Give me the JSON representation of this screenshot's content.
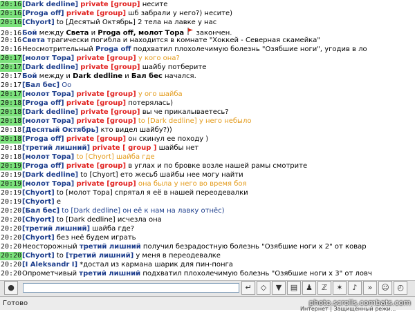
{
  "chat": {
    "rows": [
      {
        "time": "20:16",
        "hl": true,
        "segs": [
          {
            "t": "[Dark dedline]",
            "c": "nick"
          },
          {
            "t": " "
          },
          {
            "t": "private [group]",
            "c": "priv"
          },
          {
            "t": " несите"
          }
        ]
      },
      {
        "time": "20:16",
        "hl": true,
        "segs": [
          {
            "t": "[Proga off]",
            "c": "nick"
          },
          {
            "t": " "
          },
          {
            "t": "private [group]",
            "c": "priv"
          },
          {
            "t": " шб забрали у него?) несите)"
          }
        ]
      },
      {
        "time": "20:16",
        "hl": true,
        "segs": [
          {
            "t": "[Chyort]",
            "c": "nick"
          },
          {
            "t": " to [Десятый Октябрь] 2 тела на лавке у нас"
          }
        ]
      },
      {
        "time": "20:16",
        "hl": false,
        "segs": [
          {
            "t": "Бой",
            "c": "blu bold"
          },
          {
            "t": " между "
          },
          {
            "t": "Света",
            "c": "bold"
          },
          {
            "t": " и "
          },
          {
            "t": "Proga off, молот Тора",
            "c": "bold"
          },
          {
            "t": " ",
            "icon": "flag-icon"
          },
          {
            "t": " закончен."
          }
        ]
      },
      {
        "time": "20:16",
        "hl": false,
        "segs": [
          {
            "t": "Света",
            "c": "blu bold"
          },
          {
            "t": " трагически погибла и находится в комнате \"Хоккей - Северная скамейка\""
          }
        ]
      },
      {
        "time": "20:16",
        "hl": false,
        "segs": [
          {
            "t": "Неосмотрительный "
          },
          {
            "t": "Proga off",
            "c": "blu bold"
          },
          {
            "t": " подхватил плохолечимую болезнь \"Озябшие ноги\", угодив в ло"
          }
        ]
      },
      {
        "time": "20:17",
        "hl": true,
        "segs": [
          {
            "t": "[молот Тора]",
            "c": "nick"
          },
          {
            "t": " "
          },
          {
            "t": "private [group]",
            "c": "priv"
          },
          {
            "t": " у кого она?",
            "c": "ora"
          }
        ]
      },
      {
        "time": "20:17",
        "hl": true,
        "segs": [
          {
            "t": "[Dark dedline]",
            "c": "nick"
          },
          {
            "t": " "
          },
          {
            "t": "private [group]",
            "c": "priv"
          },
          {
            "t": " шайбу потберите"
          }
        ]
      },
      {
        "time": "20:17",
        "hl": false,
        "segs": [
          {
            "t": "Бой",
            "c": "blu bold"
          },
          {
            "t": " между и "
          },
          {
            "t": "Dark dedline",
            "c": "bold"
          },
          {
            "t": " и "
          },
          {
            "t": "Бал бес",
            "c": "bold"
          },
          {
            "t": " начался."
          }
        ]
      },
      {
        "time": "20:17",
        "hl": false,
        "segs": [
          {
            "t": "[Бал бес]",
            "c": "nick"
          },
          {
            "t": " Оо",
            "c": "blu"
          }
        ]
      },
      {
        "time": "20:17",
        "hl": true,
        "segs": [
          {
            "t": "[молот Тора]",
            "c": "nick"
          },
          {
            "t": " "
          },
          {
            "t": "private [group]",
            "c": "priv"
          },
          {
            "t": " у ого шайба",
            "c": "ora"
          }
        ]
      },
      {
        "time": "20:18",
        "hl": true,
        "segs": [
          {
            "t": "[Proga off]",
            "c": "nick"
          },
          {
            "t": " "
          },
          {
            "t": "private [group]",
            "c": "priv"
          },
          {
            "t": " потерялась)"
          }
        ]
      },
      {
        "time": "20:18",
        "hl": true,
        "segs": [
          {
            "t": "[Dark dedline]",
            "c": "nick"
          },
          {
            "t": " "
          },
          {
            "t": "private [group]",
            "c": "priv"
          },
          {
            "t": " вы че прикалываетесь?"
          }
        ]
      },
      {
        "time": "20:18",
        "hl": true,
        "segs": [
          {
            "t": "[молот Тора]",
            "c": "nick"
          },
          {
            "t": " "
          },
          {
            "t": "private [group]",
            "c": "priv"
          },
          {
            "t": " to [Dark dedline] у него небыло",
            "c": "ora"
          }
        ]
      },
      {
        "time": "20:18",
        "hl": false,
        "segs": [
          {
            "t": "[Десятый Октябрь]",
            "c": "nick"
          },
          {
            "t": " кто видел шайбу?))"
          }
        ]
      },
      {
        "time": "20:18",
        "hl": true,
        "segs": [
          {
            "t": "[Proga off]",
            "c": "nick"
          },
          {
            "t": " "
          },
          {
            "t": "private [group]",
            "c": "priv"
          },
          {
            "t": " он скинул ее походу )"
          }
        ]
      },
      {
        "time": "20:18",
        "hl": false,
        "segs": [
          {
            "t": "[третий лишний]",
            "c": "nick"
          },
          {
            "t": " "
          },
          {
            "t": "private [ group ]",
            "c": "priv"
          },
          {
            "t": " шайбы нет"
          }
        ]
      },
      {
        "time": "20:18",
        "hl": false,
        "segs": [
          {
            "t": "[молот Тора]",
            "c": "nick"
          },
          {
            "t": " to [Chyort] шайба где",
            "c": "ora"
          }
        ]
      },
      {
        "time": "20:19",
        "hl": true,
        "segs": [
          {
            "t": "[Proga off]",
            "c": "nick"
          },
          {
            "t": " "
          },
          {
            "t": "private [group]",
            "c": "priv"
          },
          {
            "t": " в углах и по бровке возле нашей рамы смотрите"
          }
        ]
      },
      {
        "time": "20:19",
        "hl": false,
        "segs": [
          {
            "t": "[Dark dedline]",
            "c": "nick"
          },
          {
            "t": " to [Chyort] ето жесьб шайбы нее могу найти"
          }
        ]
      },
      {
        "time": "20:19",
        "hl": true,
        "segs": [
          {
            "t": "[молот Тора]",
            "c": "nick"
          },
          {
            "t": " "
          },
          {
            "t": "private [group]",
            "c": "priv"
          },
          {
            "t": " она была у него во время боя",
            "c": "ora"
          }
        ]
      },
      {
        "time": "20:19",
        "hl": false,
        "segs": [
          {
            "t": "[Chyort]",
            "c": "nick"
          },
          {
            "t": " to [молот Тора] спрятал я её в нашей переодевалки"
          }
        ]
      },
      {
        "time": "20:19",
        "hl": false,
        "segs": [
          {
            "t": "[Chyort]",
            "c": "nick"
          },
          {
            "t": " е"
          }
        ]
      },
      {
        "time": "20:20",
        "hl": false,
        "segs": [
          {
            "t": "[Бал бес]",
            "c": "nick"
          },
          {
            "t": " to [Dark dedline] он её к нам на лавку отнёс)",
            "c": "blu"
          }
        ]
      },
      {
        "time": "20:20",
        "hl": false,
        "segs": [
          {
            "t": "[Chyort]",
            "c": "nick"
          },
          {
            "t": " to [Dark dedline] исчезла она"
          }
        ]
      },
      {
        "time": "20:20",
        "hl": false,
        "segs": [
          {
            "t": "[третий лишний]",
            "c": "nick"
          },
          {
            "t": " шайба где?"
          }
        ]
      },
      {
        "time": "20:20",
        "hl": false,
        "segs": [
          {
            "t": "[Chyort]",
            "c": "nick"
          },
          {
            "t": " без неё будем играть"
          }
        ]
      },
      {
        "time": "20:20",
        "hl": false,
        "segs": [
          {
            "t": "Неосторожный "
          },
          {
            "t": "третий лишний",
            "c": "blu bold"
          },
          {
            "t": " получил безрадостную болезнь \"Озябшие ноги x 2\" от ковар"
          }
        ]
      },
      {
        "time": "20:20",
        "hl": true,
        "segs": [
          {
            "t": "[Chyort]",
            "c": "nick"
          },
          {
            "t": " to "
          },
          {
            "t": "[третий лишний]",
            "c": "nick"
          },
          {
            "t": " у меня в переодевалке"
          }
        ]
      },
      {
        "time": "20:20",
        "hl": false,
        "segs": [
          {
            "t": "[I Aleksandr I]",
            "c": "nick"
          },
          {
            "t": " *достал из кармана шарик для пин-понга"
          }
        ]
      },
      {
        "time": "20:20",
        "hl": false,
        "segs": [
          {
            "t": "Опрометчивый "
          },
          {
            "t": "третий лишний",
            "c": "blu bold"
          },
          {
            "t": " подхватил плохолечимую болезнь \"Озябшие ноги x 3\" от ловч"
          }
        ]
      }
    ]
  },
  "input": {
    "value": ""
  },
  "toolbar": {
    "buttons": [
      {
        "name": "enter-button",
        "glyph": "↵"
      },
      {
        "name": "eraser-button",
        "glyph": "◇"
      },
      {
        "name": "filter-button",
        "glyph": "▼"
      },
      {
        "name": "book-button",
        "glyph": "▤"
      },
      {
        "name": "person-button",
        "glyph": "♟"
      },
      {
        "name": "mute-button",
        "glyph": "ℤ"
      },
      {
        "name": "magic-button",
        "glyph": "✶"
      },
      {
        "name": "music-button",
        "glyph": "♪"
      },
      {
        "name": "speed-button",
        "glyph": "»"
      },
      {
        "name": "smile-button",
        "glyph": "☺"
      },
      {
        "name": "clock-button",
        "glyph": "◴"
      }
    ]
  },
  "status": {
    "text": "Готово",
    "right": "Интернет | Защищённый режи..."
  },
  "watermark": "photo.scrolls.combats.com"
}
